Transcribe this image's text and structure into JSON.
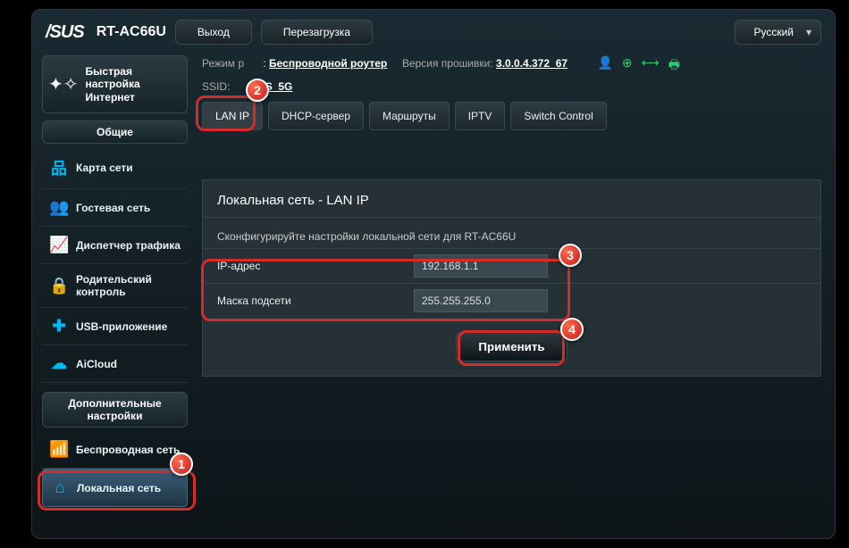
{
  "header": {
    "brand": "/SUS",
    "model": "RT-AC66U",
    "logout": "Выход",
    "reboot": "Перезагрузка",
    "language": "Русский"
  },
  "info": {
    "mode_label": "Режим р",
    "mode_value": "Беспроводной роутер",
    "ssid_label": "SSID:",
    "ssid_value": "US_5G",
    "fw_label": "Версия прошивки:",
    "fw_value": "3.0.0.4.372_67"
  },
  "sidebar": {
    "quick": "Быстрая настройка Интернет",
    "general_header": "Общие",
    "general": [
      "Карта сети",
      "Гостевая сеть",
      "Диспетчер трафика",
      "Родительский контроль",
      "USB-приложение",
      "AiCloud"
    ],
    "advanced_header": "Дополнительные настройки",
    "advanced": [
      "Беспроводная сеть",
      "Локальная сеть"
    ]
  },
  "tabs": [
    "LAN IP",
    "DHCP-сервер",
    "Маршруты",
    "IPTV",
    "Switch Control"
  ],
  "panel": {
    "title": "Локальная сеть - LAN IP",
    "desc": "Сконфигурируйте настройки локальной сети для RT-AC66U",
    "ip_label": "IP-адрес",
    "ip_value": "192.168.1.1",
    "mask_label": "Маска подсети",
    "mask_value": "255.255.255.0",
    "apply": "Применить"
  },
  "annotations": {
    "b1": "1",
    "b2": "2",
    "b3": "3",
    "b4": "4"
  }
}
